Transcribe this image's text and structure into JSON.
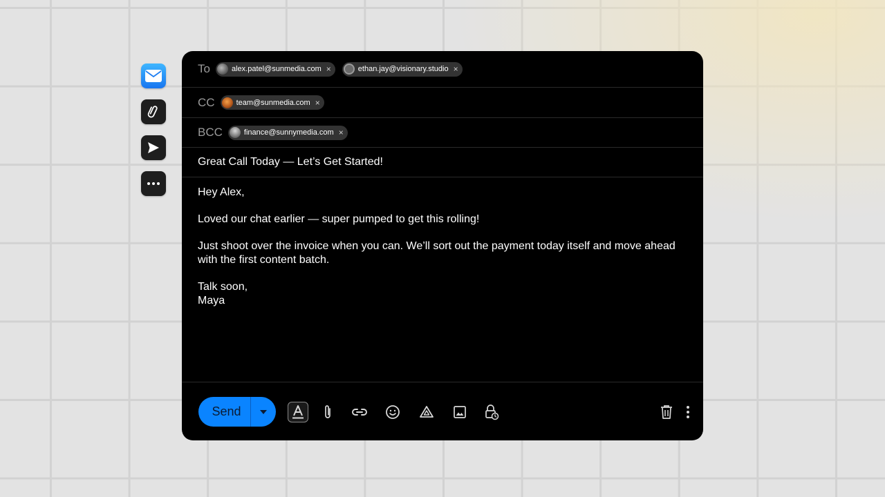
{
  "dock": {
    "items": [
      {
        "name": "mail",
        "icon": "mail-icon"
      },
      {
        "name": "attachments",
        "icon": "paperclip-icon"
      },
      {
        "name": "sent",
        "icon": "send-icon"
      },
      {
        "name": "more",
        "icon": "more-horizontal-icon"
      }
    ]
  },
  "compose": {
    "to_label": "To",
    "cc_label": "CC",
    "bcc_label": "BCC",
    "to": [
      "alex.patel@sunmedia.com",
      "ethan.jay@visionary.studio"
    ],
    "cc": [
      "team@sunmedia.com"
    ],
    "bcc": [
      "finance@sunnymedia.com"
    ],
    "remove_glyph": "×",
    "subject": "Great Call Today — Let’s Get Started!",
    "body": {
      "greeting": "Hey Alex,",
      "p1": "Loved our chat earlier — super pumped to get this rolling!",
      "p2": "Just shoot over the invoice when you can. We’ll sort out the payment today itself and move ahead with the first content batch.",
      "signoff": "Talk soon,",
      "signature": "Maya"
    }
  },
  "toolbar": {
    "send_label": "Send",
    "format_glyph": "A",
    "accent_color": "#0a84ff"
  }
}
